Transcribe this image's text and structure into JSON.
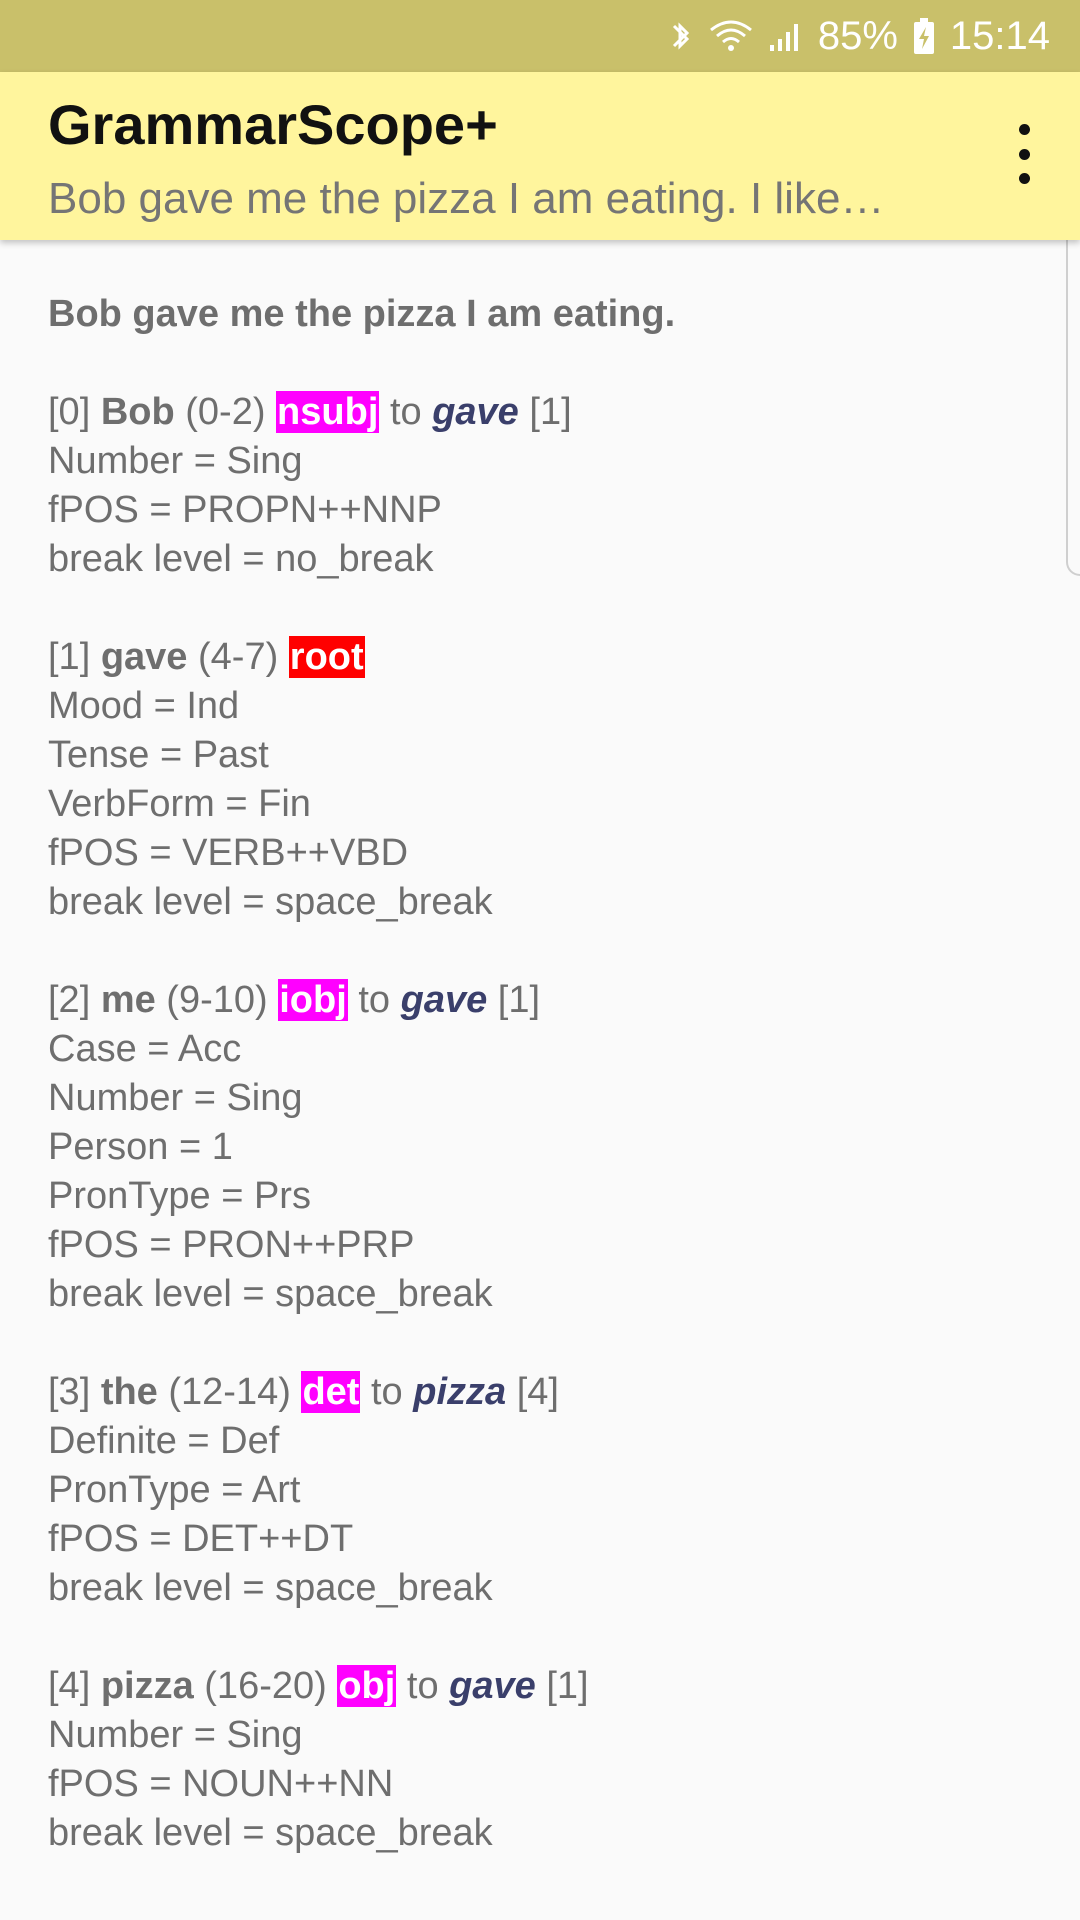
{
  "status_bar": {
    "battery": "85%",
    "time": "15:14",
    "icons": [
      "bluetooth-icon",
      "wifi-icon",
      "signal-icon",
      "battery-charging-icon"
    ]
  },
  "app_bar": {
    "title": "GrammarScope+",
    "subtitle": "Bob gave me the pizza I am eating. I like…"
  },
  "content": {
    "sentence": "Bob gave me the pizza I am eating.",
    "tokens": [
      {
        "index": "[0]",
        "word": "Bob",
        "span": "(0-2)",
        "dep": "nsubj",
        "dep_color": "#ff00ff",
        "has_gov": true,
        "to": "to",
        "gov_word": "gave",
        "gov_index": "[1]",
        "features": [
          "Number = Sing",
          "fPOS = PROPN++NNP",
          "break level = no_break"
        ]
      },
      {
        "index": "[1]",
        "word": "gave",
        "span": "(4-7)",
        "dep": "root",
        "dep_color": "#ff0000",
        "has_gov": false,
        "features": [
          "Mood = Ind",
          "Tense = Past",
          "VerbForm = Fin",
          "fPOS = VERB++VBD",
          "break level = space_break"
        ]
      },
      {
        "index": "[2]",
        "word": "me",
        "span": "(9-10)",
        "dep": "iobj",
        "dep_color": "#ff00ff",
        "has_gov": true,
        "to": "to",
        "gov_word": "gave",
        "gov_index": "[1]",
        "features": [
          "Case = Acc",
          "Number = Sing",
          "Person = 1",
          "PronType = Prs",
          "fPOS = PRON++PRP",
          "break level = space_break"
        ]
      },
      {
        "index": "[3]",
        "word": "the",
        "span": "(12-14)",
        "dep": "det",
        "dep_color": "#ff00ff",
        "has_gov": true,
        "to": "to",
        "gov_word": "pizza",
        "gov_index": "[4]",
        "features": [
          "Definite = Def",
          "PronType = Art",
          "fPOS = DET++DT",
          "break level = space_break"
        ]
      },
      {
        "index": "[4]",
        "word": "pizza",
        "span": "(16-20)",
        "dep": "obj",
        "dep_color": "#ff00ff",
        "has_gov": true,
        "to": "to",
        "gov_word": "gave",
        "gov_index": "[1]",
        "features": [
          "Number = Sing",
          "fPOS = NOUN++NN",
          "break level = space_break"
        ]
      }
    ]
  }
}
